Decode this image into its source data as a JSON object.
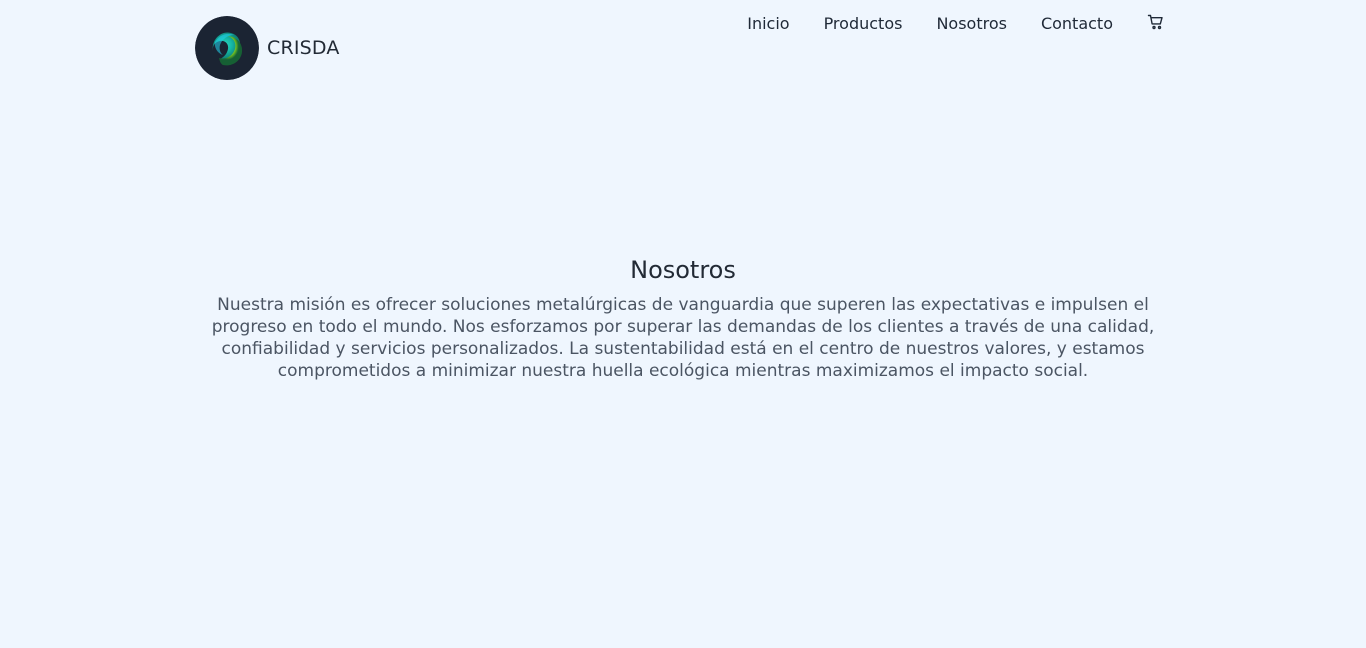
{
  "brand": {
    "name": "CRISDA",
    "logo_icon": "swirl-logo-icon"
  },
  "nav": {
    "items": [
      {
        "label": "Inicio"
      },
      {
        "label": "Productos"
      },
      {
        "label": "Nosotros"
      },
      {
        "label": "Contacto"
      }
    ],
    "cart_icon": "cart-icon"
  },
  "about": {
    "title": "Nosotros",
    "text": "Nuestra misión es ofrecer soluciones metalúrgicas de vanguardia que superen las expectativas e impulsen el progreso en todo el mundo. Nos esforzamos por superar las demandas de los clientes a través de una calidad, confiabilidad y servicios personalizados. La sustentabilidad está en el centro de nuestros valores, y estamos comprometidos a minimizar nuestra huella ecológica mientras maximizamos el impacto social."
  },
  "colors": {
    "background": "#eff6fe",
    "text": "#1f2937",
    "muted_text": "#4b5563",
    "logo_bg": "#1b2433"
  }
}
